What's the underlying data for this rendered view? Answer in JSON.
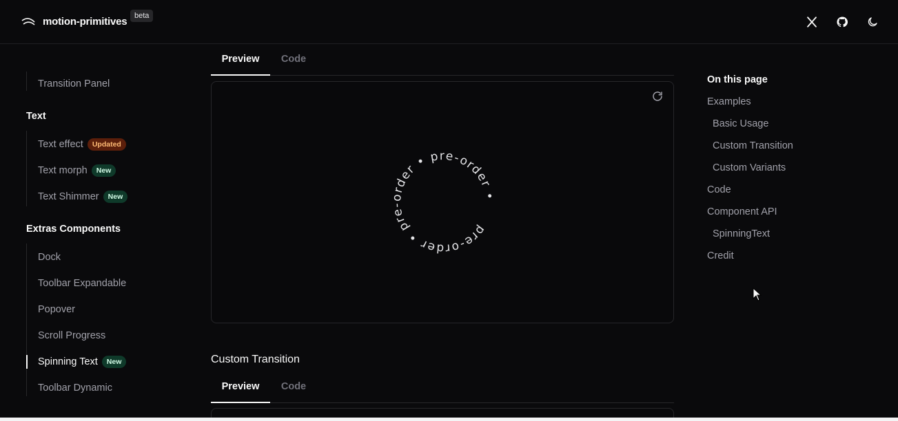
{
  "header": {
    "brand": "motion-primitives",
    "beta": "beta",
    "icons": [
      "x-logo-icon",
      "github-icon",
      "moon-icon"
    ]
  },
  "sidebar": {
    "top_item": "Transition Panel",
    "text_heading": "Text",
    "text_items": [
      {
        "label": "Text effect",
        "badge": "Updated"
      },
      {
        "label": "Text morph",
        "badge": "New"
      },
      {
        "label": "Text Shimmer",
        "badge": "New"
      }
    ],
    "extras_heading": "Extras Components",
    "extras_items": [
      {
        "label": "Dock"
      },
      {
        "label": "Toolbar Expandable"
      },
      {
        "label": "Popover"
      },
      {
        "label": "Scroll Progress"
      },
      {
        "label": "Spinning Text",
        "badge": "New",
        "active": true
      },
      {
        "label": "Toolbar Dynamic"
      }
    ]
  },
  "main": {
    "tabs": [
      {
        "label": "Preview"
      },
      {
        "label": "Code"
      }
    ],
    "spinning_text": "pre-order • pre-order • pre-order • ",
    "section_title": "Custom Transition",
    "tabs2": [
      {
        "label": "Preview"
      },
      {
        "label": "Code"
      }
    ]
  },
  "toc": {
    "title": "On this page",
    "items": [
      {
        "label": "Examples",
        "indent": false
      },
      {
        "label": "Basic Usage",
        "indent": true
      },
      {
        "label": "Custom Transition",
        "indent": true
      },
      {
        "label": "Custom Variants",
        "indent": true
      },
      {
        "label": "Code",
        "indent": false
      },
      {
        "label": "Component API",
        "indent": false
      },
      {
        "label": "SpinningText",
        "indent": true
      },
      {
        "label": "Credit",
        "indent": false
      }
    ]
  },
  "colors": {
    "background": "#0a0a0c",
    "text_primary": "#fafafa",
    "text_muted": "#a1a1aa",
    "badge_updated": "#5c1f0b",
    "badge_new": "#0f3a2a"
  }
}
